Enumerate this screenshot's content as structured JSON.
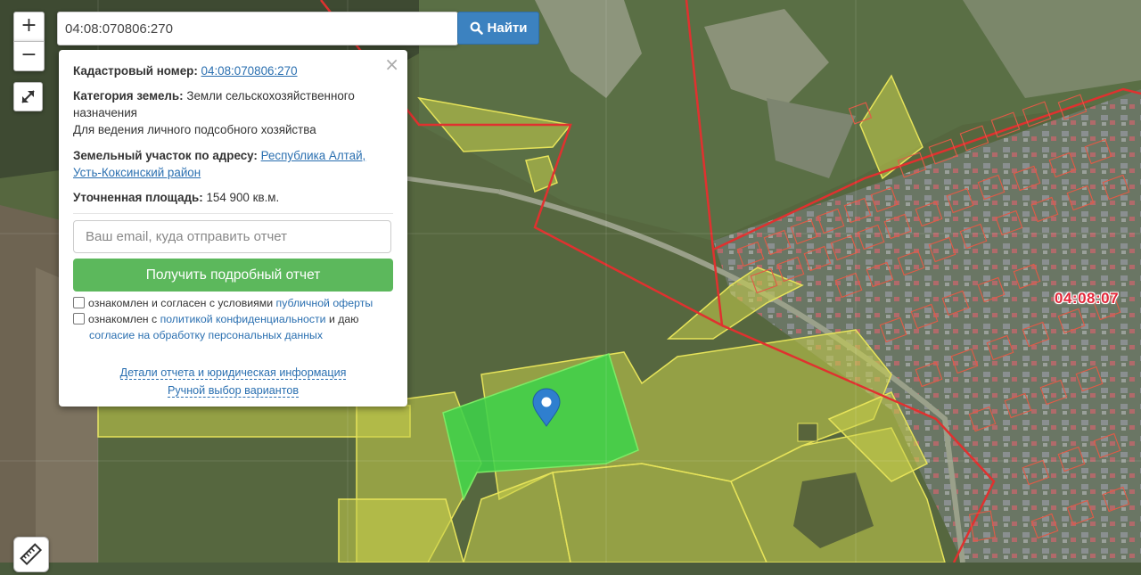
{
  "search": {
    "value": "04:08:070806:270",
    "button_label": "Найти"
  },
  "zoom": {
    "in_label": "+",
    "out_label": "−"
  },
  "info": {
    "cadastral_label": "Кадастровый номер:",
    "cadastral_value": "04:08:070806:270",
    "category_label": "Категория земель:",
    "category_value_line1": "Земли сельскохозяйственного",
    "category_value_line2": "назначения",
    "usage_value": "Для ведения личного подсобного хозяйства",
    "address_label": "Земельный участок по адресу:",
    "address_link_part1": "Республика Алтай,",
    "address_link_part2": "Усть-Коксинский район",
    "area_label": "Уточненная площадь:",
    "area_value": "154 900 кв.м.",
    "close_label": "×",
    "email_placeholder": "Ваш email, куда отправить отчет",
    "report_button_label": "Получить подробный отчет",
    "consent1_text": "ознакомлен и согласен с условиями",
    "consent1_link": "публичной оферты",
    "consent2_text": "ознакомлен с",
    "consent2_link": "политикой конфиденциальности",
    "consent2_text2": "и даю",
    "consent2_link2": "согласие на обработку персональных данных",
    "details_link": "Детали отчета и юридическая информация",
    "manual_link": "Ручной выбор вариантов"
  },
  "map": {
    "parcel_label": "04:08:07",
    "colors": {
      "selected_parcel": "#3fd24a",
      "parcels": "#d8e04a",
      "boundaries": "#e0312f",
      "marker": "#2f7fcf"
    }
  }
}
